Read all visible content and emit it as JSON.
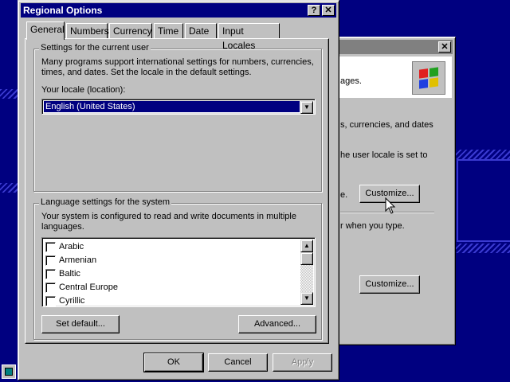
{
  "back_window": {
    "close_symbol": "✕",
    "line1": "ages.",
    "line2": "s, currencies, and dates",
    "line3": "he user locale is set to",
    "line4": "e.",
    "customize_button_1": "Customize...",
    "line5": "r when you type.",
    "customize_button_2": "Customize..."
  },
  "dialog": {
    "title": "Regional Options",
    "help_symbol": "?",
    "close_symbol": "✕",
    "tabs": [
      {
        "label": "General"
      },
      {
        "label": "Numbers"
      },
      {
        "label": "Currency"
      },
      {
        "label": "Time"
      },
      {
        "label": "Date"
      },
      {
        "label": "Input Locales"
      }
    ],
    "current_user": {
      "group_title": "Settings for the current user",
      "description_line1": "Many programs support international settings for numbers, currencies,",
      "description_line2": "times, and dates. Set the locale in the default settings.",
      "locale_label": "Your locale (location):",
      "locale_value": "English (United States)"
    },
    "language": {
      "group_title": "Language settings for the system",
      "description_line1": "Your system is configured to read and write documents in multiple",
      "description_line2": "languages.",
      "items": [
        {
          "label": "Arabic"
        },
        {
          "label": "Armenian"
        },
        {
          "label": "Baltic"
        },
        {
          "label": "Central Europe"
        },
        {
          "label": "Cyrillic"
        }
      ],
      "set_default_button": "Set default...",
      "advanced_button": "Advanced..."
    },
    "ok_button": "OK",
    "cancel_button": "Cancel",
    "apply_button": "Apply"
  },
  "colors": {
    "desktop": "#000080",
    "selection": "#000080",
    "face": "#c0c0c0"
  }
}
